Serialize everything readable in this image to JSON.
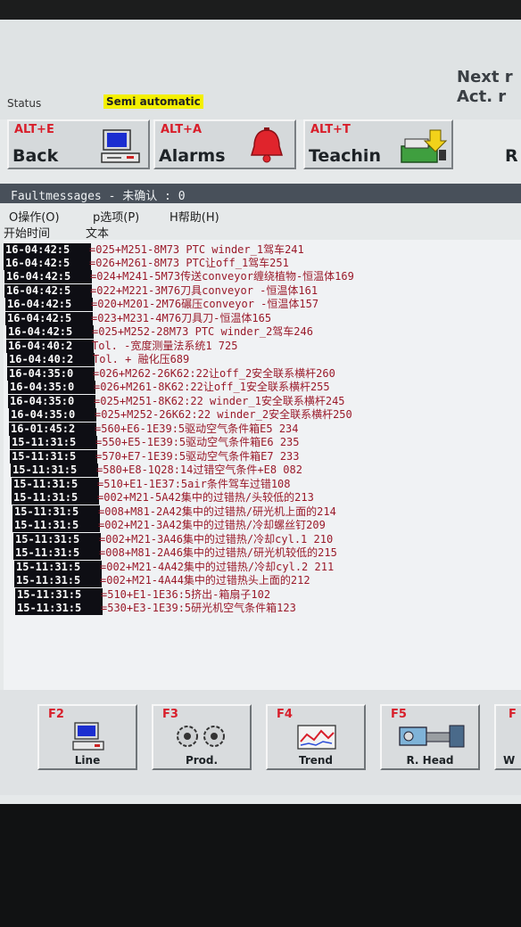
{
  "topbar": {
    "next_label": "Next r",
    "act_label": "Act. r",
    "status_label": "Status",
    "mode": "Semi automatic"
  },
  "alt_buttons": [
    {
      "key": "ALT+E",
      "label": "Back",
      "icon": "monitor-icon"
    },
    {
      "key": "ALT+A",
      "label": "Alarms",
      "icon": "bell-icon"
    },
    {
      "key": "ALT+T",
      "label": "Teachin",
      "icon": "teach-icon"
    }
  ],
  "right_fragment": "R",
  "fault_panel": {
    "title": "Faultmessages - 未确认 : 0",
    "menu": [
      "O操作(O)",
      "p选项(P)",
      "H帮助(H)"
    ],
    "columns": [
      "开始时间",
      "文本"
    ],
    "rows": [
      {
        "time": "16-04:42:5",
        "text": "=025+M251-8M73  PTC winder_1驾车241"
      },
      {
        "time": "16-04:42:5",
        "text": "=026+M261-8M73 PTC让off_1驾车251"
      },
      {
        "time": "16-04:42:5",
        "text": "=024+M241-5M73传送conveyor缠绕植物-恒温体169"
      },
      {
        "time": "16-04:42:5",
        "text": "=022+M221-3M76刀具conveyor -恒温体161"
      },
      {
        "time": "16-04:42:5",
        "text": "=020+M201-2M76碾压conveyor -恒温体157"
      },
      {
        "time": "16-04:42:5",
        "text": "=023+M231-4M76刀具刀-恒温体165"
      },
      {
        "time": "16-04:42:5",
        "text": "=025+M252-28M73 PTC winder_2驾车246"
      },
      {
        "time": "16-04:40:2",
        "text": "Tol. -宽度测量法系统1                725"
      },
      {
        "time": "16-04:40:2",
        "text": "Tol. +  融化压689"
      },
      {
        "time": "16-04:35:0",
        "text": "=026+M262-26K62:22让off_2安全联系横杆260"
      },
      {
        "time": "16-04:35:0",
        "text": "=026+M261-8K62:22让off_1安全联系横杆255"
      },
      {
        "time": "16-04:35:0",
        "text": "=025+M251-8K62:22 winder_1安全联系横杆245"
      },
      {
        "time": "16-04:35:0",
        "text": "=025+M252-26K62:22 winder_2安全联系横杆250"
      },
      {
        "time": "16-01:45:2",
        "text": "=560+E6-1E39:5驱动空气条件箱E5     234"
      },
      {
        "time": "15-11:31:5",
        "text": "=550+E5-1E39:5驱动空气条件箱E6     235"
      },
      {
        "time": "15-11:31:5",
        "text": "=570+E7-1E39:5驱动空气条件箱E7     233"
      },
      {
        "time": "15-11:31:5",
        "text": "=580+E8-1Q28:14过错空气条件+E8                082"
      },
      {
        "time": "15-11:31:5",
        "text": "=510+E1-1E37:5air条件驾车过错108"
      },
      {
        "time": "15-11:31:5",
        "text": "=002+M21-5A42集中的过错热/头较低的213"
      },
      {
        "time": "15-11:31:5",
        "text": "=008+M81-2A42集中的过错热/研光机上面的214"
      },
      {
        "time": "15-11:31:5",
        "text": "=002+M21-3A42集中的过错热/冷却螺丝钉209"
      },
      {
        "time": "15-11:31:5",
        "text": "=002+M21-3A46集中的过错热/冷却cyl.1   210"
      },
      {
        "time": "15-11:31:5",
        "text": "=008+M81-2A46集中的过错热/研光机较低的215"
      },
      {
        "time": "15-11:31:5",
        "text": "=002+M21-4A42集中的过错热/冷却cyl.2   211"
      },
      {
        "time": "15-11:31:5",
        "text": "=002+M21-4A44集中的过错热头上面的212"
      },
      {
        "time": "15-11:31:5",
        "text": "=510+E1-1E36:5挤出-箱扇子102"
      },
      {
        "time": "15-11:31:5",
        "text": "=530+E3-1E39:5研光机空气条件箱123"
      }
    ]
  },
  "function_keys": [
    {
      "key": "F2",
      "label": "Line",
      "icon": "line-monitor-icon"
    },
    {
      "key": "F3",
      "label": "Prod.",
      "icon": "gears-icon"
    },
    {
      "key": "F4",
      "label": "Trend",
      "icon": "trend-chart-icon"
    },
    {
      "key": "F5",
      "label": "R. Head",
      "icon": "machine-head-icon"
    },
    {
      "key": "F",
      "label": "W",
      "icon": ""
    }
  ],
  "colors": {
    "accent_red": "#d81e2a",
    "mode_badge": "#f4f000",
    "header_bar": "#48505a",
    "message_text": "#9a1a2a"
  }
}
